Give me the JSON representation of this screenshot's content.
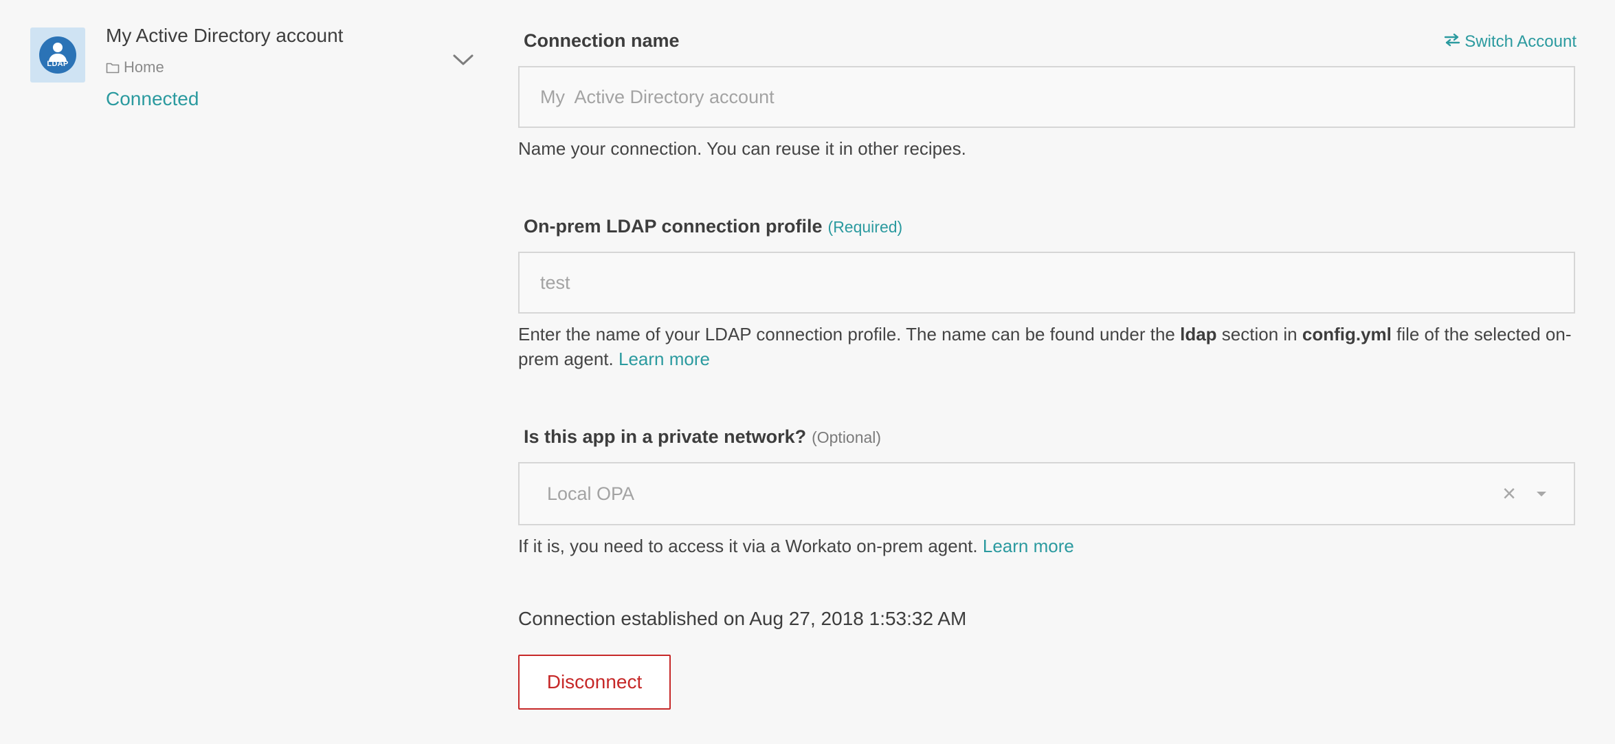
{
  "account": {
    "logo_text": "LDAP",
    "name": "My Active Directory account",
    "folder": "Home",
    "status": "Connected",
    "status_color": "#2b9a9f",
    "logo_background": "#cfe3f3",
    "logo_color": "#2b73b6"
  },
  "header": {
    "switch_account_label": "Switch Account",
    "switch_account_icon": "swap-arrows-icon"
  },
  "form": {
    "connection_name": {
      "label": "Connection name",
      "value": "My  Active Directory account",
      "hint": "Name your connection. You can reuse it in other recipes."
    },
    "ldap_profile": {
      "label": "On-prem LDAP connection profile",
      "tag": "(Required)",
      "value": "test",
      "hint_part1": "Enter the name of your LDAP connection profile. The name can be found under the ",
      "hint_bold1": "ldap",
      "hint_part2": " section in ",
      "hint_bold2": "config.yml",
      "hint_part3": " file of the selected on-prem agent. ",
      "hint_link": "Learn more"
    },
    "private_network": {
      "label": "Is this app in a private network?",
      "tag": "(Optional)",
      "selected": "Local OPA",
      "hint_text": "If it is, you need to access it via a Workato on-prem agent. ",
      "hint_link": "Learn more"
    }
  },
  "footer": {
    "established": "Connection established on Aug 27, 2018 1:53:32 AM",
    "disconnect_label": "Disconnect",
    "disconnect_color": "#c62828"
  },
  "icons": {
    "folder": "folder-icon",
    "chevron": "chevron-down-icon",
    "clear": "clear-icon",
    "caret": "caret-down-icon"
  }
}
